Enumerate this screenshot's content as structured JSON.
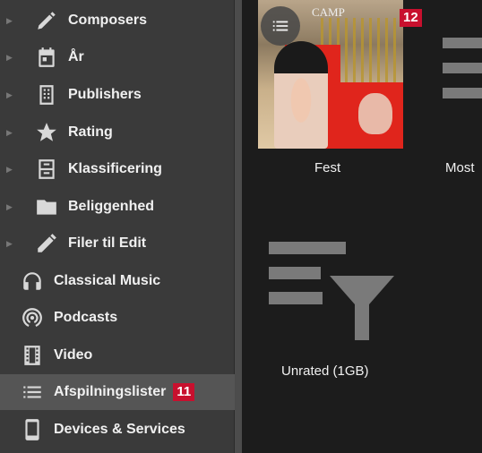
{
  "sidebar": {
    "items": [
      {
        "label": "Composers",
        "icon": "pen-icon"
      },
      {
        "label": "År",
        "icon": "calendar-icon"
      },
      {
        "label": "Publishers",
        "icon": "building-icon"
      },
      {
        "label": "Rating",
        "icon": "star-icon"
      },
      {
        "label": "Klassificering",
        "icon": "cabinet-icon"
      },
      {
        "label": "Beliggenhed",
        "icon": "folder-icon"
      },
      {
        "label": "Filer til Edit",
        "icon": "pencil-icon"
      },
      {
        "label": "Classical Music",
        "icon": "headphones-icon"
      },
      {
        "label": "Podcasts",
        "icon": "podcast-icon"
      },
      {
        "label": "Video",
        "icon": "film-icon"
      },
      {
        "label": "Afspilningslister",
        "icon": "list-icon",
        "badge": "11",
        "selected": true
      },
      {
        "label": "Devices & Services",
        "icon": "phone-icon"
      }
    ]
  },
  "main": {
    "tiles": [
      {
        "caption": "Fest",
        "badge": "12",
        "art_text": "CAMP"
      },
      {
        "caption": "Most"
      },
      {
        "caption": "Unrated (1GB)"
      }
    ]
  },
  "colors": {
    "sidebar_bg": "#3a3a3a",
    "main_bg": "#1c1c1c",
    "selected_bg": "#555555",
    "badge_red": "#c8102e",
    "icon_gray": "#7a7a7a"
  }
}
